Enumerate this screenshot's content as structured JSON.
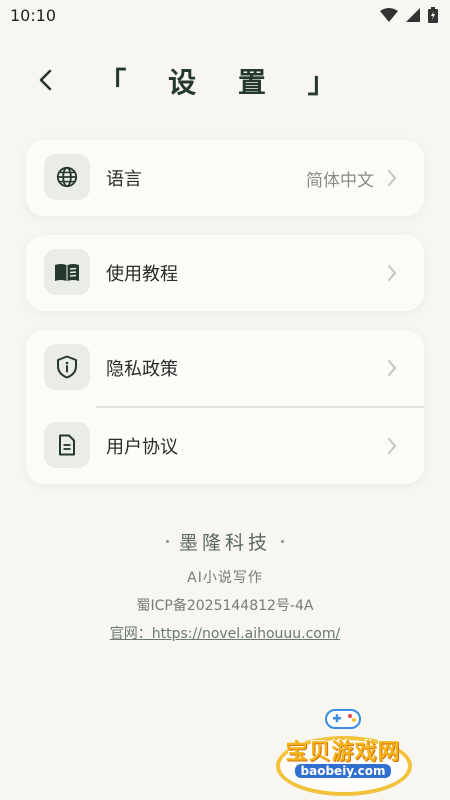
{
  "status_bar": {
    "time": "10:10"
  },
  "header": {
    "title": "「 设 置 」"
  },
  "settings": {
    "language": {
      "label": "语言",
      "value": "简体中文"
    },
    "tutorial": {
      "label": "使用教程"
    },
    "privacy": {
      "label": "隐私政策"
    },
    "agreement": {
      "label": "用户协议"
    }
  },
  "footer": {
    "company": "墨隆科技",
    "product": "AI小说写作",
    "icp": "蜀ICP备2025144812号-4A",
    "website": "官网：https://novel.aihouuu.com/"
  },
  "watermark": {
    "name": "宝贝游戏网",
    "url": "baobeiy.com"
  },
  "colors": {
    "background": "#f7f6f1",
    "accent": "#24392c",
    "card": "#fcfbf7",
    "icon_bg": "#eaece6"
  }
}
